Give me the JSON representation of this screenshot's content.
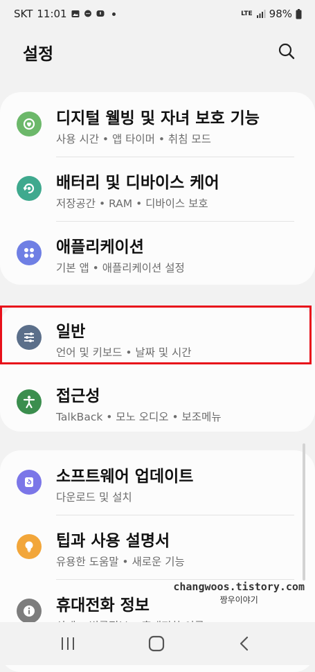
{
  "status_bar": {
    "carrier": "SKT",
    "time": "11:01",
    "lte": "LTE",
    "battery": "98%"
  },
  "header": {
    "title": "설정",
    "search_icon": "search-icon"
  },
  "groups": [
    {
      "items": [
        {
          "id": "digital-wellbeing",
          "title": "디지털 웰빙 및 자녀 보호 기능",
          "subtitle": "사용 시간 • 앱 타이머 • 취침 모드",
          "icon": "wellbeing-icon",
          "color": "#6cb86a"
        },
        {
          "id": "battery-care",
          "title": "배터리 및 디바이스 케어",
          "subtitle": "저장공간 • RAM • 디바이스 보호",
          "icon": "device-care-icon",
          "color": "#3fa98e"
        },
        {
          "id": "applications",
          "title": "애플리케이션",
          "subtitle": "기본 앱 • 애플리케이션 설정",
          "icon": "apps-icon",
          "color": "#6f7fe4"
        }
      ]
    },
    {
      "items": [
        {
          "id": "general",
          "title": "일반",
          "subtitle": "언어 및 키보드 • 날짜 및 시간",
          "icon": "sliders-icon",
          "color": "#5b6f8a"
        },
        {
          "id": "accessibility",
          "title": "접근성",
          "subtitle": "TalkBack • 모노 오디오 • 보조메뉴",
          "icon": "accessibility-icon",
          "color": "#3b8e4e"
        }
      ]
    },
    {
      "items": [
        {
          "id": "software-update",
          "title": "소프트웨어 업데이트",
          "subtitle": "다운로드 및 설치",
          "icon": "update-icon",
          "color": "#7b76e8"
        },
        {
          "id": "tips",
          "title": "팁과 사용 설명서",
          "subtitle": "유용한 도움말 • 새로운 기능",
          "icon": "lightbulb-icon",
          "color": "#f2a63a"
        },
        {
          "id": "phone-info",
          "title": "휴대전화 정보",
          "subtitle": "상태 • 법률정보 • 휴대전화 이름",
          "icon": "info-icon",
          "color": "#7d7d7d"
        }
      ]
    }
  ],
  "watermark": {
    "line1": "changwoos.tistory.com",
    "line2": "짱우이야기"
  },
  "nav": {
    "recents": "recents-icon",
    "home": "home-icon",
    "back": "back-icon"
  },
  "colors": {
    "highlight": "#e8101a",
    "background": "#f2f2f2",
    "card": "#fcfcfc"
  }
}
